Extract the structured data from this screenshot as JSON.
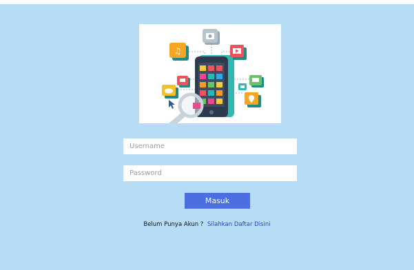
{
  "login": {
    "username_placeholder": "Username",
    "password_placeholder": "Password",
    "submit_label": "Masuk",
    "register_question": "Belum Punya Akun ?",
    "register_link": "Silahkan Daftar Disini"
  },
  "colors": {
    "background": "#b7dcf5",
    "button": "#4b6fe0",
    "link": "#2343d8",
    "phone": "#2d3b4f",
    "phone_frame": "#29b9b2"
  },
  "illustration": {
    "icons": [
      "music-icon",
      "camera-icon",
      "video-icon",
      "chat-icon",
      "cloud-icon",
      "location-icon",
      "magnifier-icon",
      "smartphone-icon",
      "cursor-icon"
    ]
  }
}
